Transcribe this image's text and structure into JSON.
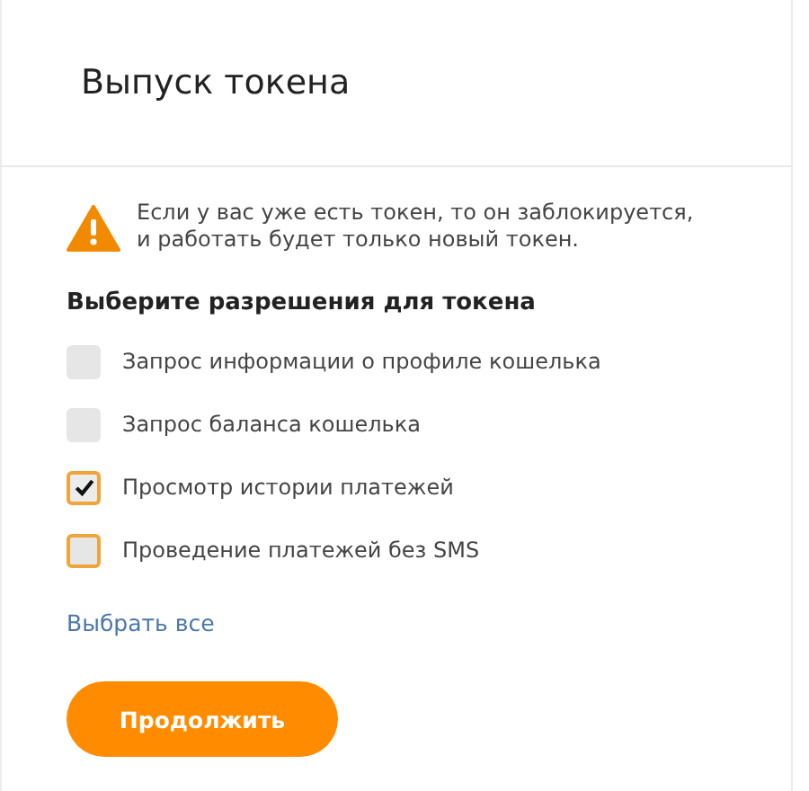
{
  "title": "Выпуск токена",
  "warning": {
    "lines": [
      "Если у вас уже есть токен, то он заблокируется,",
      "и работать будет только новый токен."
    ]
  },
  "permissions_heading": "Выберите разрешения для токена",
  "permissions": [
    {
      "label": "Запрос информации о профиле кошелька",
      "checked": false,
      "highlighted": false
    },
    {
      "label": "Запрос баланса кошелька",
      "checked": false,
      "highlighted": false
    },
    {
      "label": "Просмотр истории платежей",
      "checked": true,
      "highlighted": true
    },
    {
      "label": "Проведение платежей без SMS",
      "checked": false,
      "highlighted": true
    }
  ],
  "select_all": "Выбрать все",
  "submit": "Продолжить"
}
